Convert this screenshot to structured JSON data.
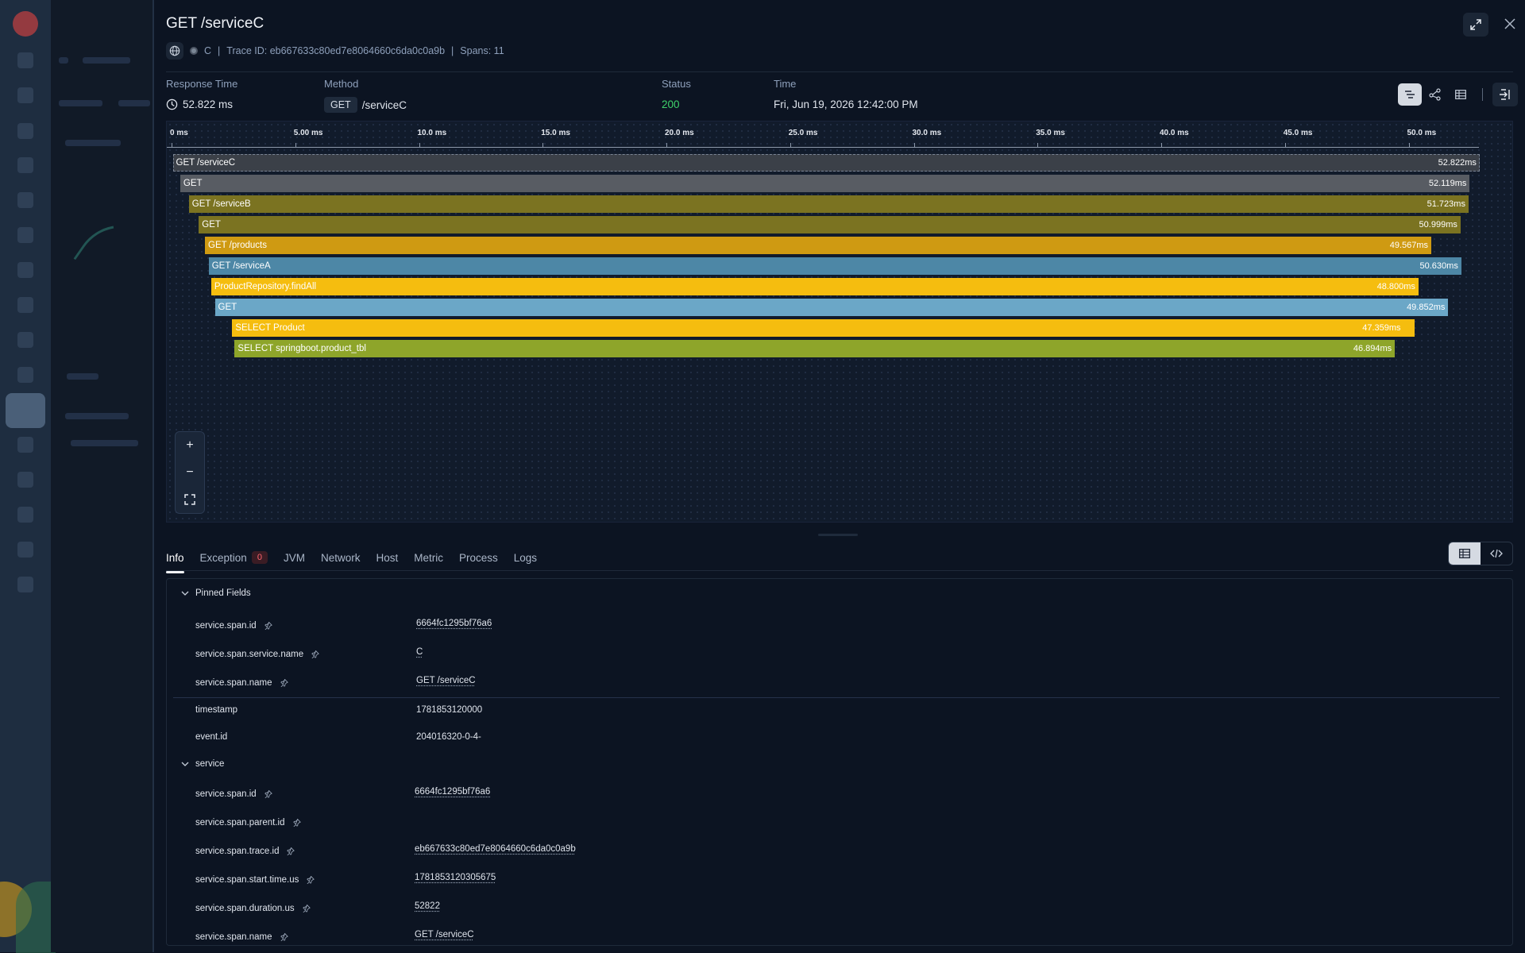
{
  "panel": {
    "title": "GET /serviceC",
    "service": "C",
    "trace_id_text": "Trace ID: eb667633c80ed7e8064660c6da0c0a9b",
    "spans_text": "Spans: 11"
  },
  "stats": {
    "response_time_label": "Response Time",
    "response_time_value": "52.822 ms",
    "method_label": "Method",
    "method_value": "GET",
    "method_path": "/serviceC",
    "status_label": "Status",
    "status_value": "200",
    "time_label": "Time",
    "time_value": "Fri, Jun 19, 2026 12:42:00 PM"
  },
  "chart_data": {
    "type": "bar",
    "x_unit": "ms",
    "xlim": [
      0,
      52.822
    ],
    "ticks": [
      "0 ms",
      "5.00 ms",
      "10.0 ms",
      "15.0 ms",
      "20.0 ms",
      "25.0 ms",
      "30.0 ms",
      "35.0 ms",
      "40.0 ms",
      "45.0 ms",
      "50.0 ms"
    ],
    "tick_values": [
      0,
      5,
      10,
      15,
      20,
      25,
      30,
      35,
      40,
      45,
      50
    ],
    "spans": [
      {
        "name": "GET /serviceC",
        "start": 0.05,
        "duration": 52.822,
        "label": "52.822ms",
        "color": "#3b4048"
      },
      {
        "name": "GET",
        "start": 0.35,
        "duration": 52.119,
        "label": "52.119ms",
        "color": "#585c63"
      },
      {
        "name": "GET /serviceB",
        "start": 0.7,
        "duration": 51.723,
        "label": "51.723ms",
        "color": "#7b7321"
      },
      {
        "name": "GET",
        "start": 1.1,
        "duration": 50.999,
        "label": "50.999ms",
        "color": "#7b7321"
      },
      {
        "name": "GET /products",
        "start": 1.35,
        "duration": 49.567,
        "label": "49.567ms",
        "color": "#cf9a12"
      },
      {
        "name": "GET /serviceA",
        "start": 1.5,
        "duration": 50.63,
        "label": "50.630ms",
        "color": "#4d87a6"
      },
      {
        "name": "ProductRepository.findAll",
        "start": 1.6,
        "duration": 48.8,
        "label": "48.800ms",
        "color": "#f5bd0f"
      },
      {
        "name": "GET",
        "start": 1.75,
        "duration": 49.852,
        "label": "49.852ms",
        "color": "#6ba7c7"
      },
      {
        "name": "SELECT Product",
        "start": 2.45,
        "duration": 47.359,
        "label": "47.359ms",
        "color": "#f5bd0f",
        "tail": 0.42
      },
      {
        "name": "SELECT springboot.product_tbl",
        "start": 2.55,
        "duration": 46.894,
        "label": "46.894ms",
        "color": "#8ea52a"
      }
    ]
  },
  "tabs": [
    {
      "label": "Info",
      "active": true
    },
    {
      "label": "Exception",
      "count": "0"
    },
    {
      "label": "JVM"
    },
    {
      "label": "Network"
    },
    {
      "label": "Host"
    },
    {
      "label": "Metric"
    },
    {
      "label": "Process"
    },
    {
      "label": "Logs"
    }
  ],
  "info": {
    "pinned_title": "Pinned Fields",
    "pinned": [
      {
        "key": "service.span.id",
        "value": "6664fc1295bf76a6"
      },
      {
        "key": "service.span.service.name",
        "value": "C"
      },
      {
        "key": "service.span.name",
        "value": "GET /serviceC"
      }
    ],
    "plain": [
      {
        "key": "timestamp",
        "value": "1781853120000"
      },
      {
        "key": "event.id",
        "value": "204016320-0-4-"
      }
    ],
    "service_title": "service",
    "service": [
      {
        "key": "service.span.id",
        "value": "6664fc1295bf76a6"
      },
      {
        "key": "service.span.parent.id",
        "value": ""
      },
      {
        "key": "service.span.trace.id",
        "value": "eb667633c80ed7e8064660c6da0c0a9b"
      },
      {
        "key": "service.span.start.time.us",
        "value": "1781853120305675"
      },
      {
        "key": "service.span.duration.us",
        "value": "52822"
      },
      {
        "key": "service.span.name",
        "value": "GET /serviceC"
      }
    ]
  },
  "icons": {
    "clock": "clock-icon",
    "globe": "globe-icon",
    "expand": "expand-icon",
    "close": "close-icon"
  }
}
